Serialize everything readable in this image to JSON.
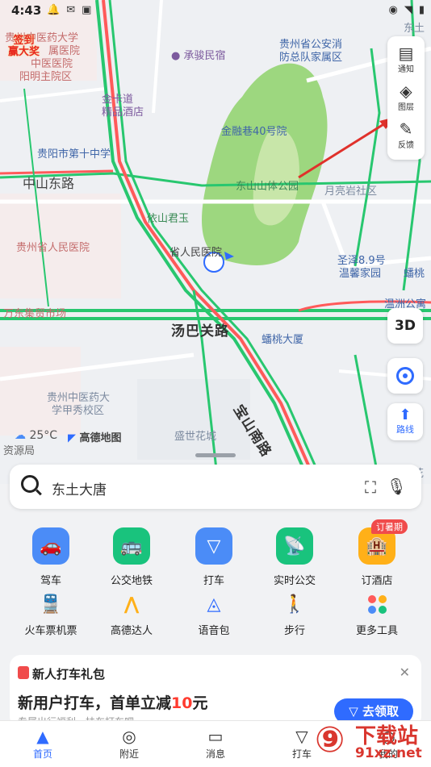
{
  "status": {
    "time": "4:43"
  },
  "map": {
    "labels": {
      "tcm_hospital": "贵州中医药大学",
      "tcm_hospital_2": "属医院",
      "tcm_hospital_3": "中医医院",
      "yangming": "阳明主院区",
      "chengjun": "承骏民宿",
      "gongan": "贵州省公安消",
      "gongan2": "防总队家属区",
      "jinka": "金卡道",
      "jinka2": "精品酒店",
      "jinrong": "金融巷40号院",
      "school": "贵阳市第十中学",
      "zhongshan": "中山东路",
      "dongshan": "东山山体公园",
      "yueliang": "月亮岩社区",
      "yishan": "依山君玉",
      "people_hospital": "贵州省人民医院",
      "sheng_hospital": "省人民医院",
      "shengjie": "圣泽8.9号",
      "wenxin": "温馨家园",
      "peitao": "蟠桃",
      "wenzhou": "温洲公寓",
      "wanche": "万东集贸市场",
      "tangba": "汤巴关路",
      "pantao_tower": "蟠桃大厦",
      "tcm_school": "贵州中医药大",
      "tcm_school2": "学甲秀校区",
      "weather": "25°C",
      "amap": "高德地图",
      "baoshan": "宝山南路",
      "shengshi": "盛世花城",
      "resource": "资源局",
      "dongtu": "东土",
      "hua": "花"
    },
    "promo_badge": {
      "line1": "签到",
      "line2": "赢大奖"
    }
  },
  "toolbar": {
    "notice": "通知",
    "layers": "图层",
    "feedback": "反馈",
    "three_d": "3D",
    "route": "路线"
  },
  "search": {
    "placeholder": "东土大唐"
  },
  "shortcuts": {
    "row1": [
      {
        "label": "驾车",
        "color": "#4b8cf7",
        "icon": "car-icon"
      },
      {
        "label": "公交地铁",
        "color": "#19c37d",
        "icon": "bus-icon"
      },
      {
        "label": "打车",
        "color": "#4b8cf7",
        "icon": "taxi-icon"
      },
      {
        "label": "实时公交",
        "color": "#19c37d",
        "icon": "realtime-bus-icon"
      },
      {
        "label": "订酒店",
        "color": "#ffb018",
        "icon": "hotel-icon",
        "badge": "订暑期"
      }
    ],
    "row2": [
      {
        "label": "火车票机票",
        "icon": "train-icon"
      },
      {
        "label": "高德达人",
        "icon": "expert-icon"
      },
      {
        "label": "语音包",
        "icon": "voice-pack-icon"
      },
      {
        "label": "步行",
        "icon": "walk-icon"
      },
      {
        "label": "更多工具",
        "icon": "more-tools-icon"
      }
    ]
  },
  "promo": {
    "title": "新人打车礼包",
    "headline_prefix": "新用户打车，首单立减",
    "headline_amount": "10",
    "headline_suffix": "元",
    "button": "去领取",
    "sub": "专属出行福利，扶车打车吧"
  },
  "bottom_nav": [
    {
      "label": "首页",
      "icon": "home-arrow-icon",
      "active": true
    },
    {
      "label": "附近",
      "icon": "location-pin-icon"
    },
    {
      "label": "消息",
      "icon": "message-icon"
    },
    {
      "label": "打车",
      "icon": "taxi-nav-icon"
    },
    {
      "label": "我的",
      "icon": "profile-icon"
    }
  ],
  "watermark": {
    "brand": "下载站",
    "domain": "91xz.net"
  }
}
